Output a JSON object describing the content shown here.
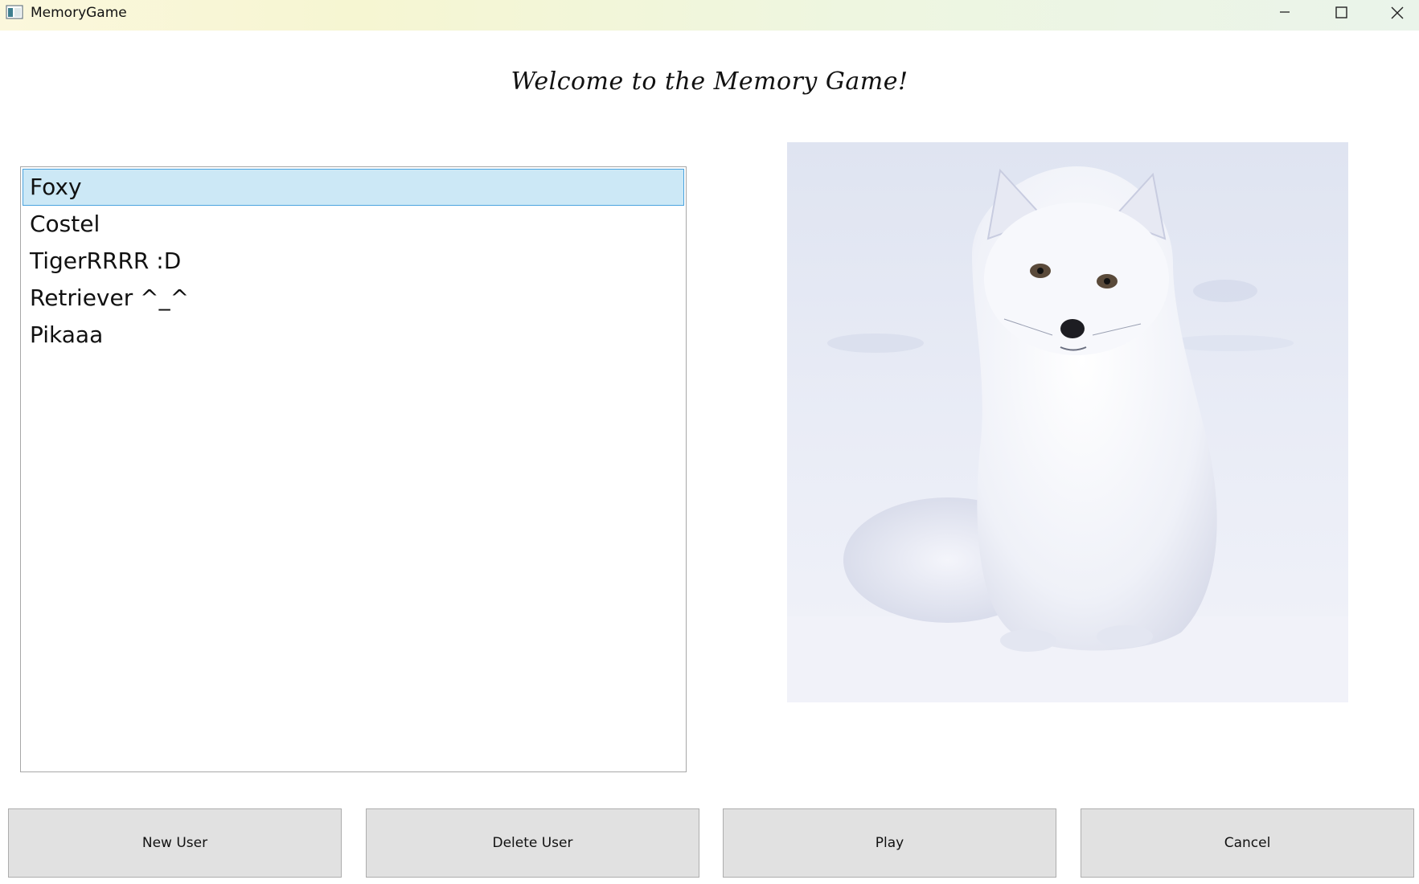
{
  "window": {
    "title": "MemoryGame"
  },
  "header": {
    "welcome": "Welcome to the Memory Game!"
  },
  "users": {
    "items": [
      "Foxy",
      "Costel",
      "TigerRRRR :D",
      "Retriever ^_^",
      "Pikaaa"
    ],
    "selected": "Foxy"
  },
  "avatar": {
    "subject": "arctic-fox-photo"
  },
  "buttons": {
    "new_user": "New User",
    "delete_user": "Delete User",
    "play": "Play",
    "cancel": "Cancel"
  },
  "colors": {
    "selection_bg": "#cce8f6",
    "selection_border": "#4aa3df",
    "button_bg": "#e1e1e1"
  }
}
